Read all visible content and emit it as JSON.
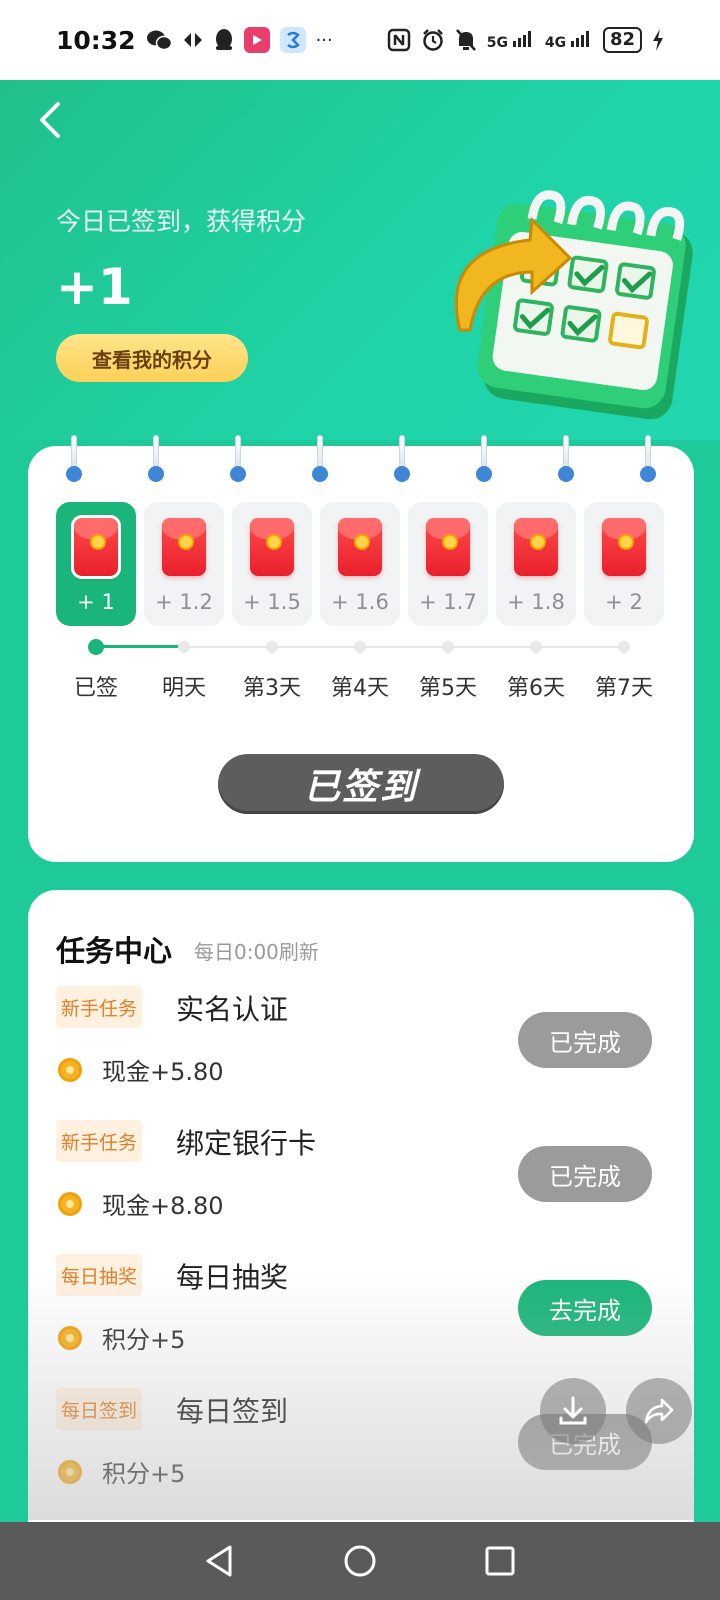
{
  "status_bar": {
    "time": "10:32",
    "more": "···",
    "battery": "82",
    "sig5g": "5G",
    "sig4g": "4G"
  },
  "header": {
    "signed_text": "今日已签到，获得积分",
    "points_gain": "+1",
    "view_points_label": "查看我的积分"
  },
  "signin": {
    "days": [
      {
        "bonus": "+ 1",
        "label": "已签"
      },
      {
        "bonus": "+ 1.2",
        "label": "明天"
      },
      {
        "bonus": "+ 1.5",
        "label": "第3天"
      },
      {
        "bonus": "+ 1.6",
        "label": "第4天"
      },
      {
        "bonus": "+ 1.7",
        "label": "第5天"
      },
      {
        "bonus": "+ 1.8",
        "label": "第6天"
      },
      {
        "bonus": "+ 2",
        "label": "第7天"
      }
    ],
    "button_label": "已签到"
  },
  "task_center": {
    "title": "任务中心",
    "subtitle": "每日0:00刷新",
    "tasks": [
      {
        "tag": "新手任务",
        "name": "实名认证",
        "reward": "现金+5.80",
        "button": "已完成",
        "done": true
      },
      {
        "tag": "新手任务",
        "name": "绑定银行卡",
        "reward": "现金+8.80",
        "button": "已完成",
        "done": true
      },
      {
        "tag": "每日抽奖",
        "name": "每日抽奖",
        "reward": "积分+5",
        "button": "去完成",
        "done": false
      },
      {
        "tag": "每日签到",
        "name": "每日签到",
        "reward": "积分+5",
        "button": "已完成",
        "done": true
      }
    ]
  },
  "colors": {
    "brand_green": "#19b57a",
    "header_teal": "#1fd4a8",
    "points_button": "#fcd158",
    "done_gray": "#9b9b9b",
    "tag_orange": "#e0802a"
  },
  "icons": {
    "back": "back-chevron-icon",
    "download": "download-icon",
    "share": "share-icon"
  }
}
